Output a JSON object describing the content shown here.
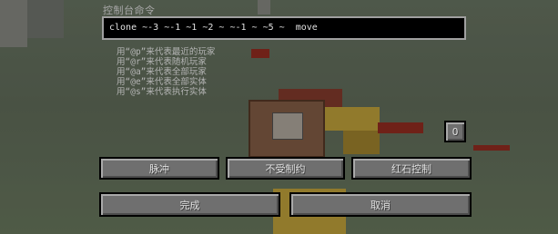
{
  "window": {
    "title": "控制台命令"
  },
  "command_input": {
    "value": "clone ~-3 ~-1 ~1 ~2 ~ ~-1 ~ ~5 ~  move"
  },
  "hints": [
    "用“@p”来代表最近的玩家",
    "用“@r”来代表随机玩家",
    "用“@a”来代表全部玩家",
    "用“@e”来代表全部实体",
    "用“@s”来代表执行实体"
  ],
  "output_toggle": {
    "label": "O"
  },
  "mode_buttons": {
    "impulse": "脉冲",
    "unconditional": "不受制约",
    "redstone": "红石控制"
  },
  "actions": {
    "done": "完成",
    "cancel": "取消"
  },
  "colors": {
    "button_face": "#6f6f6f",
    "input_bg": "#000000",
    "input_border": "#a0a0a0",
    "hint_text": "#b5b5b5"
  }
}
